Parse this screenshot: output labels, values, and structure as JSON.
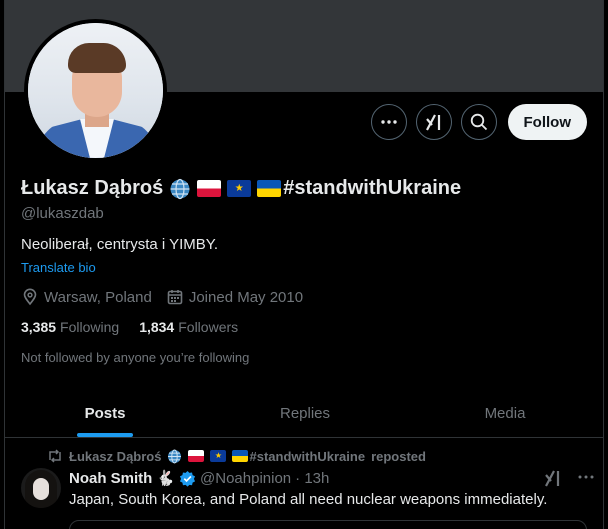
{
  "profile": {
    "name": "Łukasz Dąbroś",
    "hashtag": "#standwithUkraine",
    "handle": "@lukaszdab",
    "bio": "Neoliberał, centrysta i YIMBY.",
    "translate_label": "Translate bio",
    "location": "Warsaw, Poland",
    "joined": "Joined May 2010",
    "following_count": "3,385",
    "following_label": "Following",
    "followers_count": "1,834",
    "followers_label": "Followers",
    "not_followed": "Not followed by anyone you’re following",
    "name_icons": [
      "globe-icon",
      "poland-flag-icon",
      "eu-flag-icon",
      "ukraine-flag-icon"
    ]
  },
  "actions": {
    "follow_label": "Follow",
    "icons": [
      "more-icon",
      "grok-icon",
      "search-icon"
    ]
  },
  "tabs": [
    {
      "label": "Posts",
      "active": true
    },
    {
      "label": "Replies",
      "active": false
    },
    {
      "label": "Media",
      "active": false
    }
  ],
  "feed": {
    "repost_name": "Łukasz Dąbroś",
    "repost_hashtag": "#standwithUkraine",
    "repost_suffix": "reposted",
    "tweet": {
      "author": "Noah Smith",
      "author_emoji": "🐇",
      "handle": "@Noahpinion",
      "time": "· 13h",
      "text": "Japan, South Korea, and Poland all need nuclear weapons immediately."
    }
  },
  "colors": {
    "accent": "#1d9bf0",
    "background": "#000000",
    "banner": "#333639",
    "muted": "#71767b",
    "text": "#e7e9ea"
  }
}
